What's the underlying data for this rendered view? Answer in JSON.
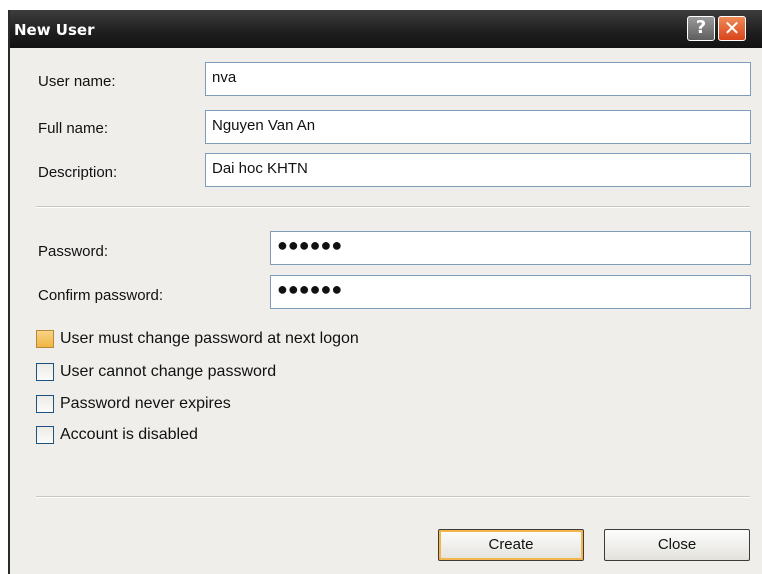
{
  "window": {
    "title": "New User",
    "help_label": "?",
    "close_label": "✕"
  },
  "fields": {
    "username": {
      "label": "User name:",
      "value": "nva"
    },
    "fullname": {
      "label": "Full name:",
      "value": "Nguyen Van An"
    },
    "description": {
      "label": "Description:",
      "value": "Dai hoc KHTN"
    },
    "password": {
      "label": "Password:",
      "value": "●●●●●●"
    },
    "confirm": {
      "label": "Confirm password:",
      "value": "●●●●●●"
    }
  },
  "options": [
    {
      "label": "User must change password at next logon",
      "checked": false
    },
    {
      "label": "User cannot change password",
      "checked": false
    },
    {
      "label": "Password never expires",
      "checked": false
    },
    {
      "label": "Account is disabled",
      "checked": false
    }
  ],
  "buttons": {
    "create": "Create",
    "close": "Close"
  },
  "colors": {
    "titlebar": "#1e1e1e",
    "close_button": "#d9441b",
    "focus_checkbox": "#f0b540",
    "dialog_background": "#efeeea"
  }
}
